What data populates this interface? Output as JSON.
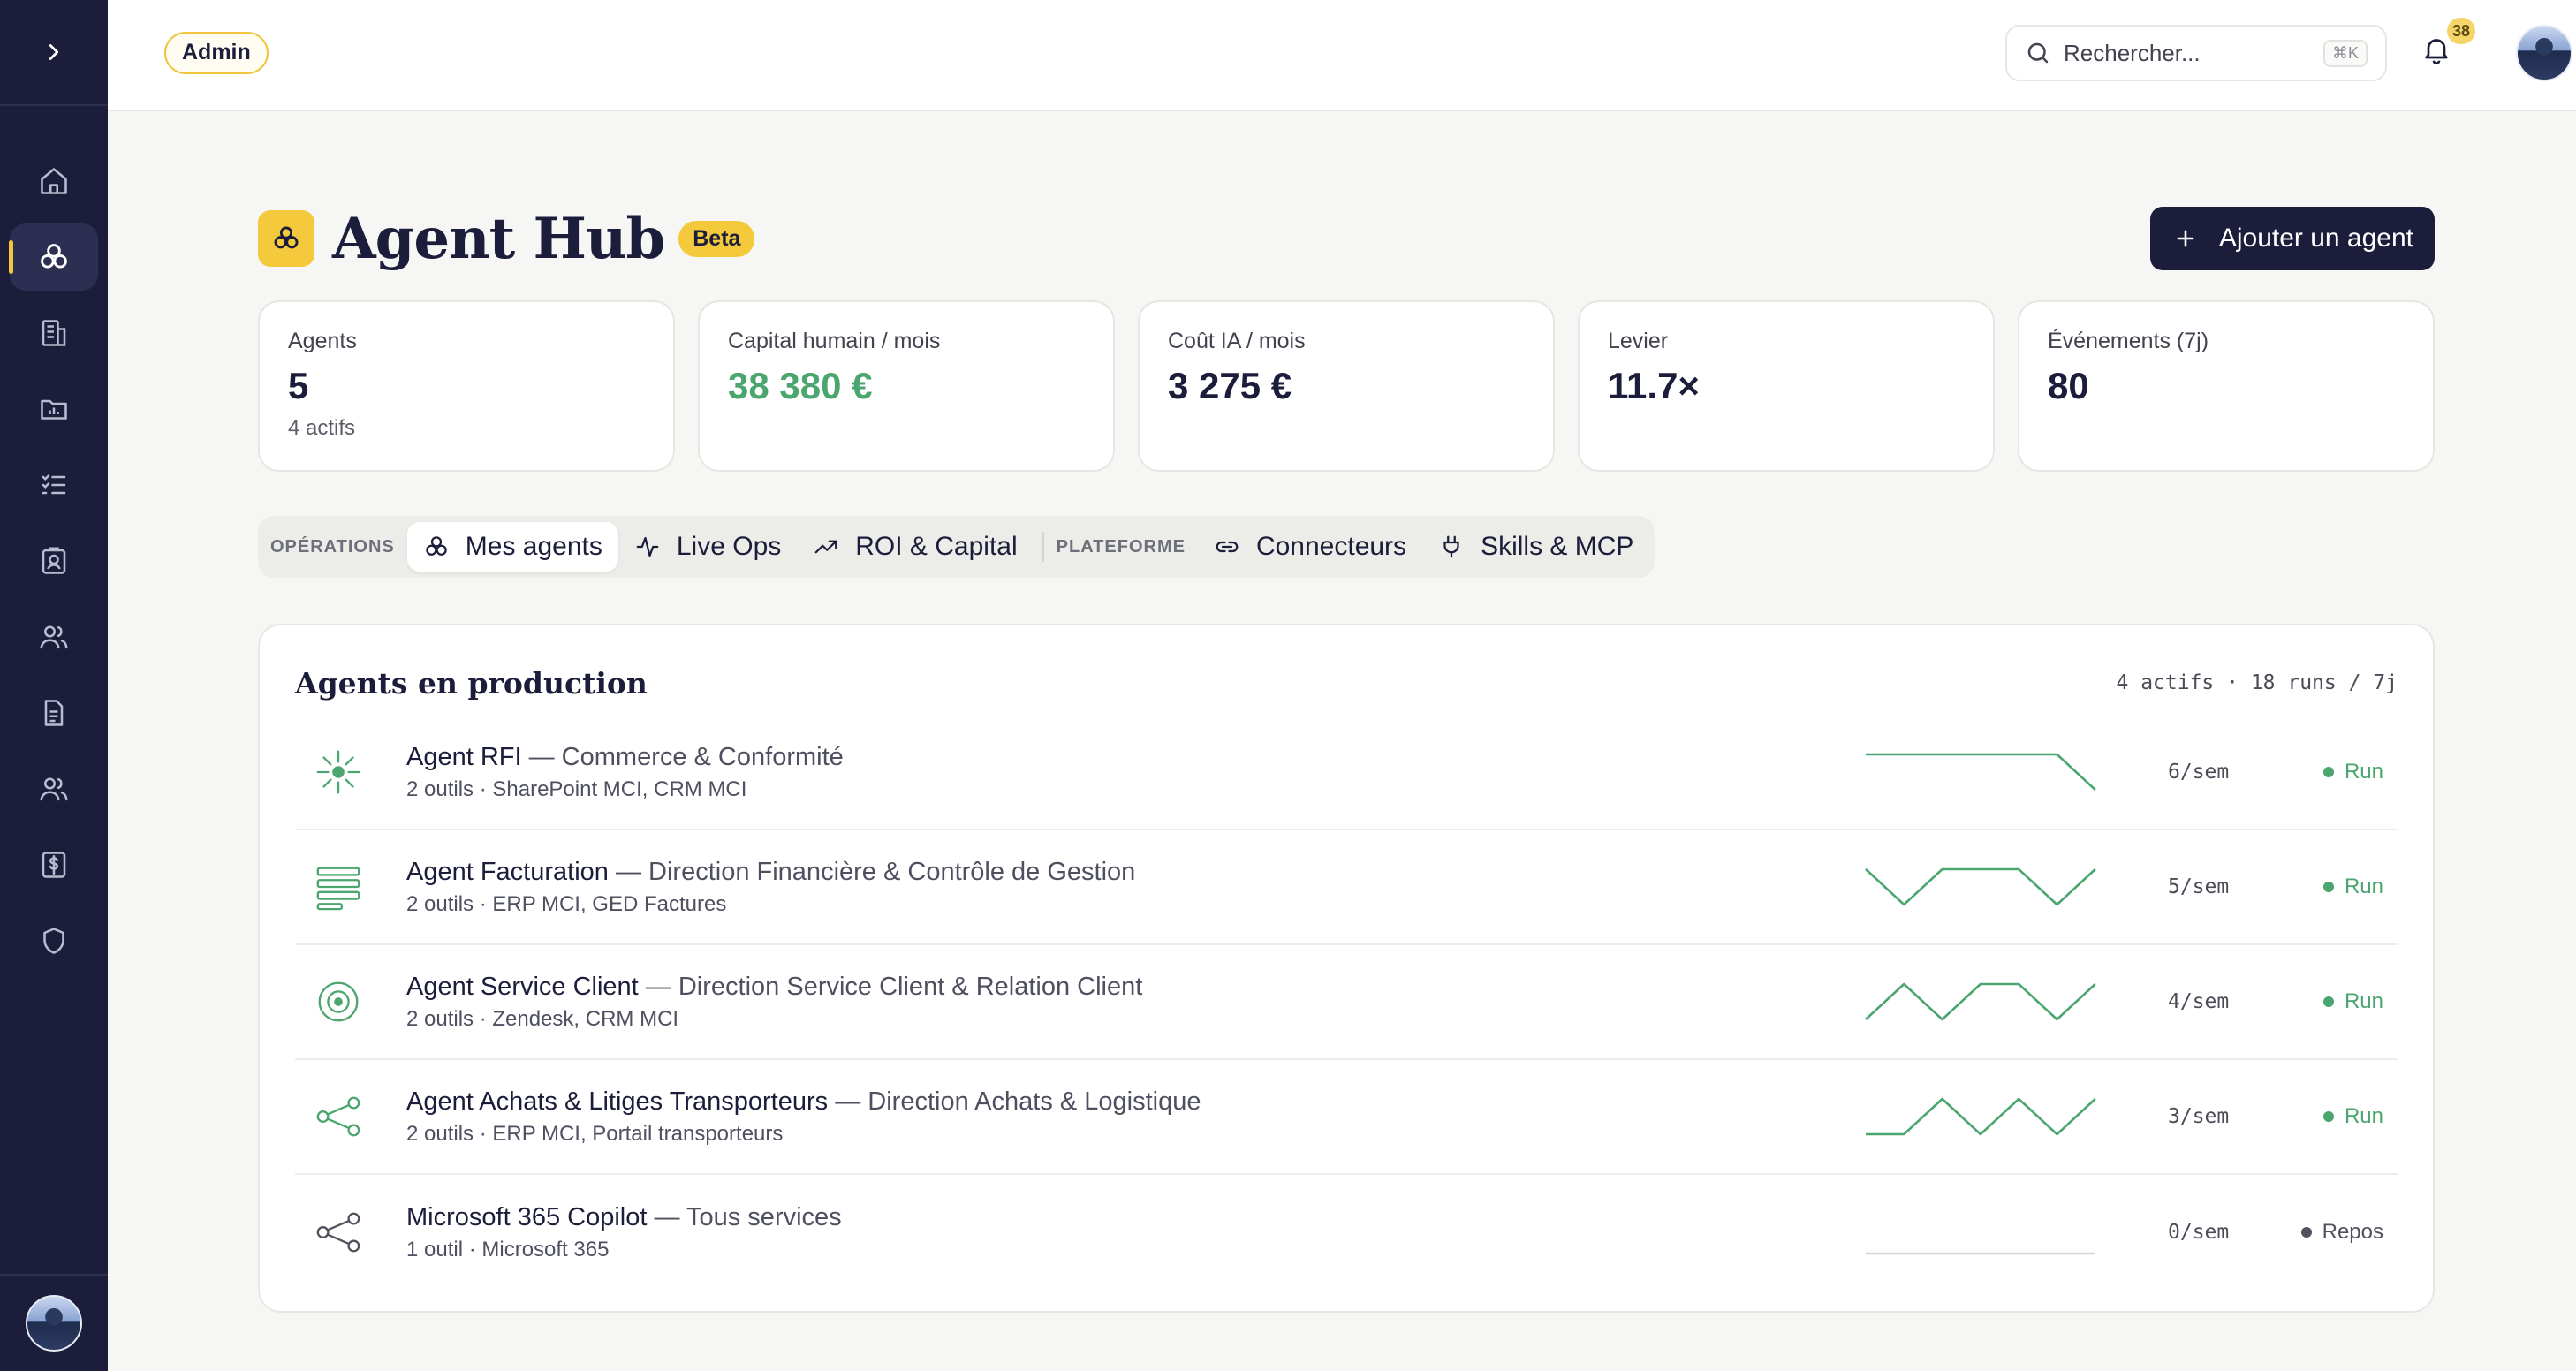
{
  "topbar": {
    "role_badge": "Admin",
    "search_placeholder": "Rechercher...",
    "search_shortcut": "⌘K",
    "notifications_count": "38"
  },
  "page": {
    "title": "Agent Hub",
    "badge": "Beta",
    "add_button": "Ajouter un agent"
  },
  "kpis": [
    {
      "label": "Agents",
      "value": "5",
      "sub": "4 actifs"
    },
    {
      "label": "Capital humain / mois",
      "value": "38 380 €",
      "sub": ""
    },
    {
      "label": "Coût IA / mois",
      "value": "3 275 €",
      "sub": ""
    },
    {
      "label": "Levier",
      "value": "11.7×",
      "sub": ""
    },
    {
      "label": "Événements (7j)",
      "value": "80",
      "sub": ""
    }
  ],
  "tabs": {
    "group_operations": "OPÉRATIONS",
    "group_platform": "PLATEFORME",
    "mes_agents": "Mes agents",
    "live_ops": "Live Ops",
    "roi": "ROI & Capital",
    "connecteurs": "Connecteurs",
    "skills": "Skills & MCP"
  },
  "panel": {
    "title": "Agents en production",
    "meta": "4 actifs · 18 runs / 7j"
  },
  "agents": [
    {
      "name": "Agent RFI",
      "dept": " — Commerce & Conformité",
      "tools": "2 outils · SharePoint MCI, CRM MCI",
      "rate": "6/sem",
      "status": "Run",
      "icon": "sparkle-icon",
      "trend": [
        1,
        1,
        1,
        1,
        1,
        1,
        0
      ]
    },
    {
      "name": "Agent Facturation",
      "dept": " — Direction Financière & Contrôle de Gestion",
      "tools": "2 outils · ERP MCI, GED Factures",
      "rate": "5/sem",
      "status": "Run",
      "icon": "stack-icon",
      "trend": [
        1,
        0,
        1,
        1,
        1,
        0,
        1
      ]
    },
    {
      "name": "Agent Service Client",
      "dept": " — Direction Service Client & Relation Client",
      "tools": "2 outils · Zendesk, CRM MCI",
      "rate": "4/sem",
      "status": "Run",
      "icon": "target-icon",
      "trend": [
        0,
        1,
        0,
        1,
        1,
        0,
        1
      ]
    },
    {
      "name": "Agent Achats & Litiges Transporteurs",
      "dept": " — Direction Achats & Logistique",
      "tools": "2 outils · ERP MCI, Portail transporteurs",
      "rate": "3/sem",
      "status": "Run",
      "icon": "share-icon",
      "trend": [
        0,
        0,
        1,
        0,
        1,
        0,
        1
      ]
    },
    {
      "name": "Microsoft 365 Copilot",
      "dept": " — Tous services",
      "tools": "1 outil · Microsoft 365",
      "rate": "0/sem",
      "status": "Repos",
      "icon": "share-icon",
      "trend": [
        0,
        0,
        0,
        0,
        0,
        0,
        0
      ]
    }
  ],
  "colors": {
    "sidebar_bg": "#1b1d3a",
    "accent_yellow": "#f5c93c",
    "run_green": "#4ba56e",
    "idle_gray": "#50525e"
  }
}
